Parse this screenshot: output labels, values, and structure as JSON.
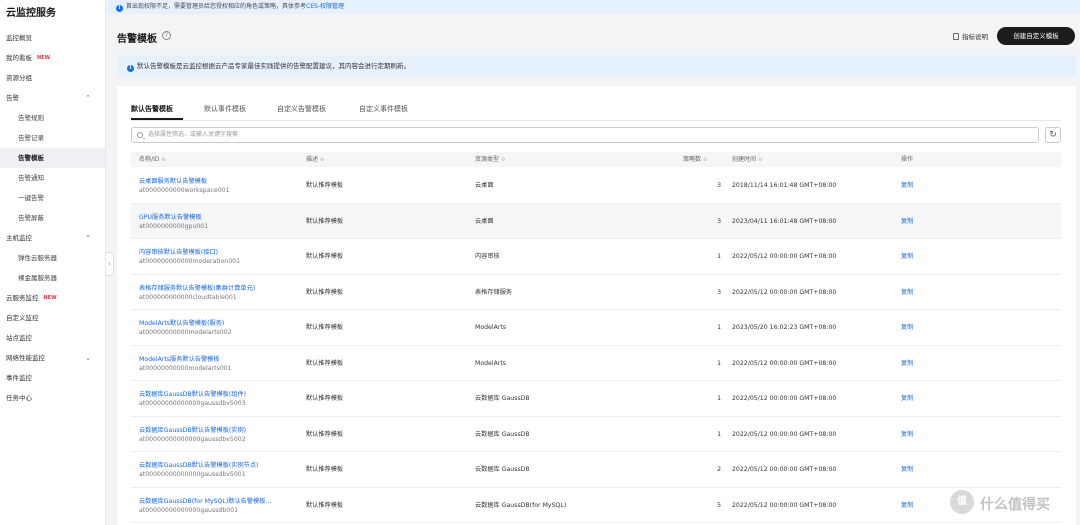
{
  "sidebar": {
    "title": "云监控服务",
    "items": [
      {
        "label": "监控概览",
        "sub": false
      },
      {
        "label": "我的看板",
        "sub": false,
        "badge": "NEW"
      },
      {
        "label": "资源分组",
        "sub": false
      },
      {
        "label": "告警",
        "sub": false,
        "arrow": "chevron-up"
      },
      {
        "label": "告警规则",
        "sub": true
      },
      {
        "label": "告警记录",
        "sub": true
      },
      {
        "label": "告警模板",
        "sub": true,
        "active": true
      },
      {
        "label": "告警通知",
        "sub": true
      },
      {
        "label": "一键告警",
        "sub": true
      },
      {
        "label": "告警屏蔽",
        "sub": true
      },
      {
        "label": "主机监控",
        "sub": false,
        "arrow": "chevron-up"
      },
      {
        "label": "弹性云服务器",
        "sub": true
      },
      {
        "label": "裸金属服务器",
        "sub": true
      },
      {
        "label": "云服务监控",
        "sub": false,
        "badge": "NEW"
      },
      {
        "label": "自定义监控",
        "sub": false
      },
      {
        "label": "站点监控",
        "sub": false
      },
      {
        "label": "网络性能监控",
        "sub": false,
        "arrow": "chevron-down"
      },
      {
        "label": "事件监控",
        "sub": false
      },
      {
        "label": "任务中心",
        "sub": false
      }
    ]
  },
  "banner": {
    "text": "首出现权限不足，需要管理员给您授权相应的角色或策略，具体参考",
    "link": "CES-权限管理"
  },
  "header": {
    "title": "告警模板",
    "doc_link": "指标说明",
    "create_button": "创建自定义模板"
  },
  "notice": {
    "text": "默认告警模板是云监控根据云产品专家最佳实践提供的告警配置建议，其内容会进行定期刷新。"
  },
  "tabs": [
    "默认告警模板",
    "默认事件模板",
    "自定义告警模板",
    "自定义事件模板"
  ],
  "search": {
    "placeholder": "选择属性筛选，或输入关键字搜索"
  },
  "table": {
    "headers": {
      "name": "名称/ID",
      "desc": "描述",
      "type": "资源类型",
      "count": "策略数",
      "time": "创建时间",
      "action": "操作"
    },
    "rows": [
      {
        "name": "云桌面服务默认告警模板",
        "id": "at0000000000workspace001",
        "desc": "默认推荐模板",
        "type": "云桌面",
        "count": "3",
        "time": "2018/11/14 16:01:48 GMT+08:00",
        "action": "复制"
      },
      {
        "name": "GPU服务默认告警模板",
        "id": "at0000000000gpu001",
        "desc": "默认推荐模板",
        "type": "云桌面",
        "count": "3",
        "time": "2023/04/11 16:01:48 GMT+08:00",
        "action": "复制"
      },
      {
        "name": "内容审核默认告警模板(接口)",
        "id": "at000000000000moderation001",
        "desc": "默认推荐模板",
        "type": "内容审核",
        "count": "1",
        "time": "2022/05/12 00:00:00 GMT+08:00",
        "action": "复制"
      },
      {
        "name": "表格存储服务默认告警模板(集群计算单元)",
        "id": "at000000000000cloudtable001",
        "desc": "默认推荐模板",
        "type": "表格存储服务",
        "count": "3",
        "time": "2022/05/12 00:00:00 GMT+08:00",
        "action": "复制"
      },
      {
        "name": "ModelArts默认告警模板(服务)",
        "id": "at00000000000modelarts002",
        "desc": "默认推荐模板",
        "type": "ModelArts",
        "count": "1",
        "time": "2023/05/20 16:02:23 GMT+08:00",
        "action": "复制"
      },
      {
        "name": "ModelArts服务默认告警模板",
        "id": "at00000000000modelarts001",
        "desc": "默认推荐模板",
        "type": "ModelArts",
        "count": "1",
        "time": "2022/05/12 00:00:00 GMT+08:00",
        "action": "复制"
      },
      {
        "name": "云数据库GaussDB默认告警模板(组件)",
        "id": "at00000000000000gaussdbv5003",
        "desc": "默认推荐模板",
        "type": "云数据库 GaussDB",
        "count": "1",
        "time": "2022/05/12 00:00:00 GMT+08:00",
        "action": "复制"
      },
      {
        "name": "云数据库GaussDB默认告警模板(实例)",
        "id": "at00000000000000gaussdbv5002",
        "desc": "默认推荐模板",
        "type": "云数据库 GaussDB",
        "count": "1",
        "time": "2022/05/12 00:00:00 GMT+08:00",
        "action": "复制"
      },
      {
        "name": "云数据库GaussDB默认告警模板(实例节点)",
        "id": "at00000000000000gaussdbv5001",
        "desc": "默认推荐模板",
        "type": "云数据库 GaussDB",
        "count": "2",
        "time": "2022/05/12 00:00:00 GMT+08:00",
        "action": "复制"
      },
      {
        "name": "云数据库GaussDB(for MySQL)默认告警模板...",
        "id": "at00000000000000gaussdb001",
        "desc": "默认推荐模板",
        "type": "云数据库 GaussDB(for MySQL)",
        "count": "5",
        "time": "2022/05/12 00:00:00 GMT+08:00",
        "action": "复制"
      }
    ]
  },
  "watermark": {
    "glyph": "值",
    "text": "什么值得买"
  }
}
